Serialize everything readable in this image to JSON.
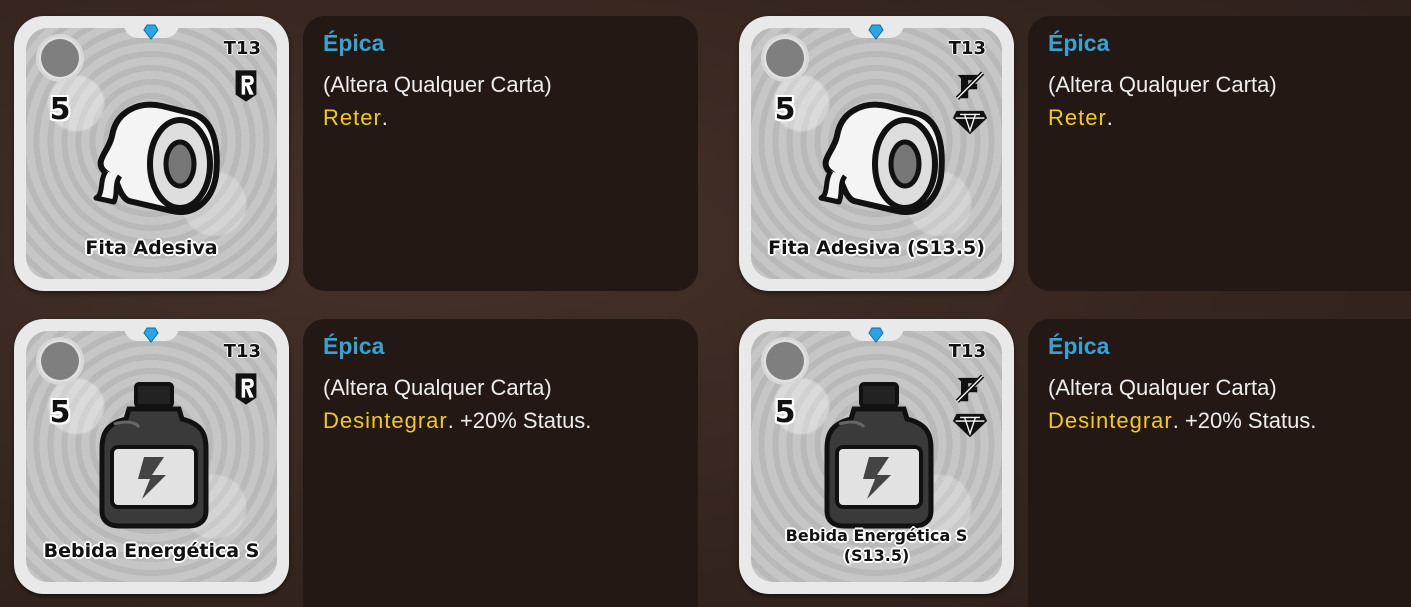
{
  "cards": [
    {
      "name": "Fita Adesiva",
      "cost": "5",
      "tier": "T13",
      "art": "tape-roll-icon",
      "badge": "rotation-r-icon",
      "rarity": "Épica",
      "type_text": "(Altera Qualquer Carta)",
      "keyword": "Reter",
      "effect": "."
    },
    {
      "name": "Fita Adesiva (S13.5)",
      "cost": "5",
      "tier": "T13",
      "art": "tape-roll-icon",
      "badge": "no-rotation-diamond-icon",
      "rarity": "Épica",
      "type_text": "(Altera Qualquer Carta)",
      "keyword": "Reter",
      "effect": "."
    },
    {
      "name": "Bebida Energética S",
      "cost": "5",
      "tier": "T13",
      "art": "energy-drink-bottle-icon",
      "badge": "rotation-r-icon",
      "rarity": "Épica",
      "type_text": "(Altera Qualquer Carta)",
      "keyword": "Desintegrar",
      "effect": ". +20% Status."
    },
    {
      "name": "Bebida Energética S (S13.5)",
      "name_line1": "Bebida Energética S",
      "name_line2": "(S13.5)",
      "cost": "5",
      "tier": "T13",
      "art": "energy-drink-bottle-icon",
      "badge": "no-rotation-diamond-icon",
      "rarity": "Épica",
      "type_text": "(Altera Qualquer Carta)",
      "keyword": "Desintegrar",
      "effect": ". +20% Status."
    }
  ],
  "colors": {
    "rarity": "#36a3d3",
    "keyword": "#f1cb19",
    "panel": "#241814",
    "background": "#3a2a22"
  }
}
